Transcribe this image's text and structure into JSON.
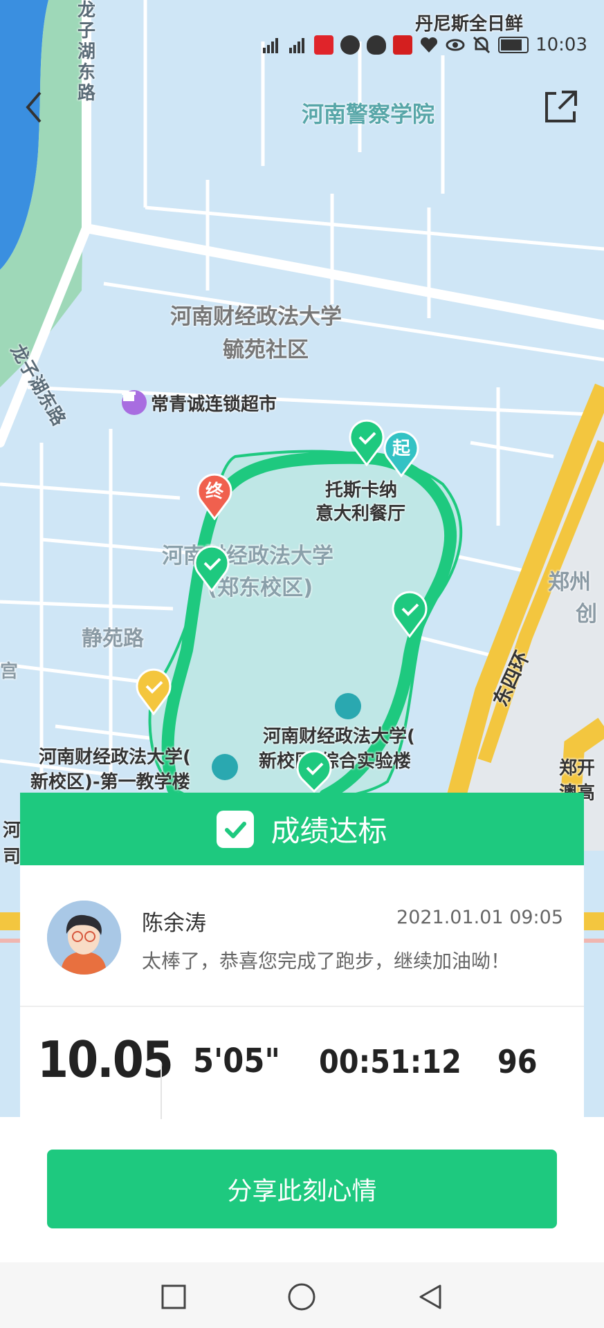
{
  "status_bar": {
    "time": "10:03",
    "network": "4G",
    "icons": [
      "hd1-icon",
      "hd2-icon",
      "signal-icon",
      "signal-icon",
      "tmall-icon",
      "direction-icon",
      "qq-icon",
      "zhihu-icon",
      "heart-rate-icon",
      "eye-icon",
      "mute-icon",
      "battery-icon"
    ]
  },
  "map": {
    "labels": {
      "longzi_road_top": "龙子湖东路",
      "police_college": "河南警察学院",
      "danis_store": "丹尼斯全日鲜",
      "hnufl_community_1": "河南财经政法大学",
      "hnufl_community_2": "毓苑社区",
      "longzi_road_left": "龙子湖东路",
      "changqing_market": "常青诚连锁超市",
      "restaurant_1": "托斯卡纳",
      "restaurant_2": "意大利餐厅",
      "zhengdong_campus_1": "河南财经政法大学",
      "zhengdong_campus_2": "(郑东校区)",
      "jingyuan_road": "静苑路",
      "zhengzhou_partial": "郑州",
      "chuang_partial": "创",
      "east_ring": "东四环",
      "lab_bldg_1": "河南财经政法大学(",
      "lab_bldg_2": "新校区)综合实验楼",
      "teaching_1_1": "河南财经政法大学(",
      "teaching_1_2": "新校区)-第一教学楼",
      "zhengkai_partial_1": "郑开",
      "zhengkai_partial_2": "澳高",
      "left_edge_1": "河",
      "left_edge_2": "司",
      "left_edge_3": "宫"
    },
    "markers": {
      "start": "起",
      "end": "终"
    },
    "route_color": "#1ec97f",
    "accent": "#1ec97f"
  },
  "result": {
    "title": "成绩达标",
    "user_name": "陈余涛",
    "datetime": "2021.01.01 09:05",
    "message": "太棒了，恭喜您完成了跑步，继续加油呦！",
    "distance": "10.05",
    "pace": "5'05\"",
    "duration": "00:51:12",
    "last_stat": "96"
  },
  "share_button": "分享此刻心情",
  "nav_bar": {
    "icons": [
      "recent-apps-icon",
      "home-icon",
      "back-icon"
    ]
  }
}
